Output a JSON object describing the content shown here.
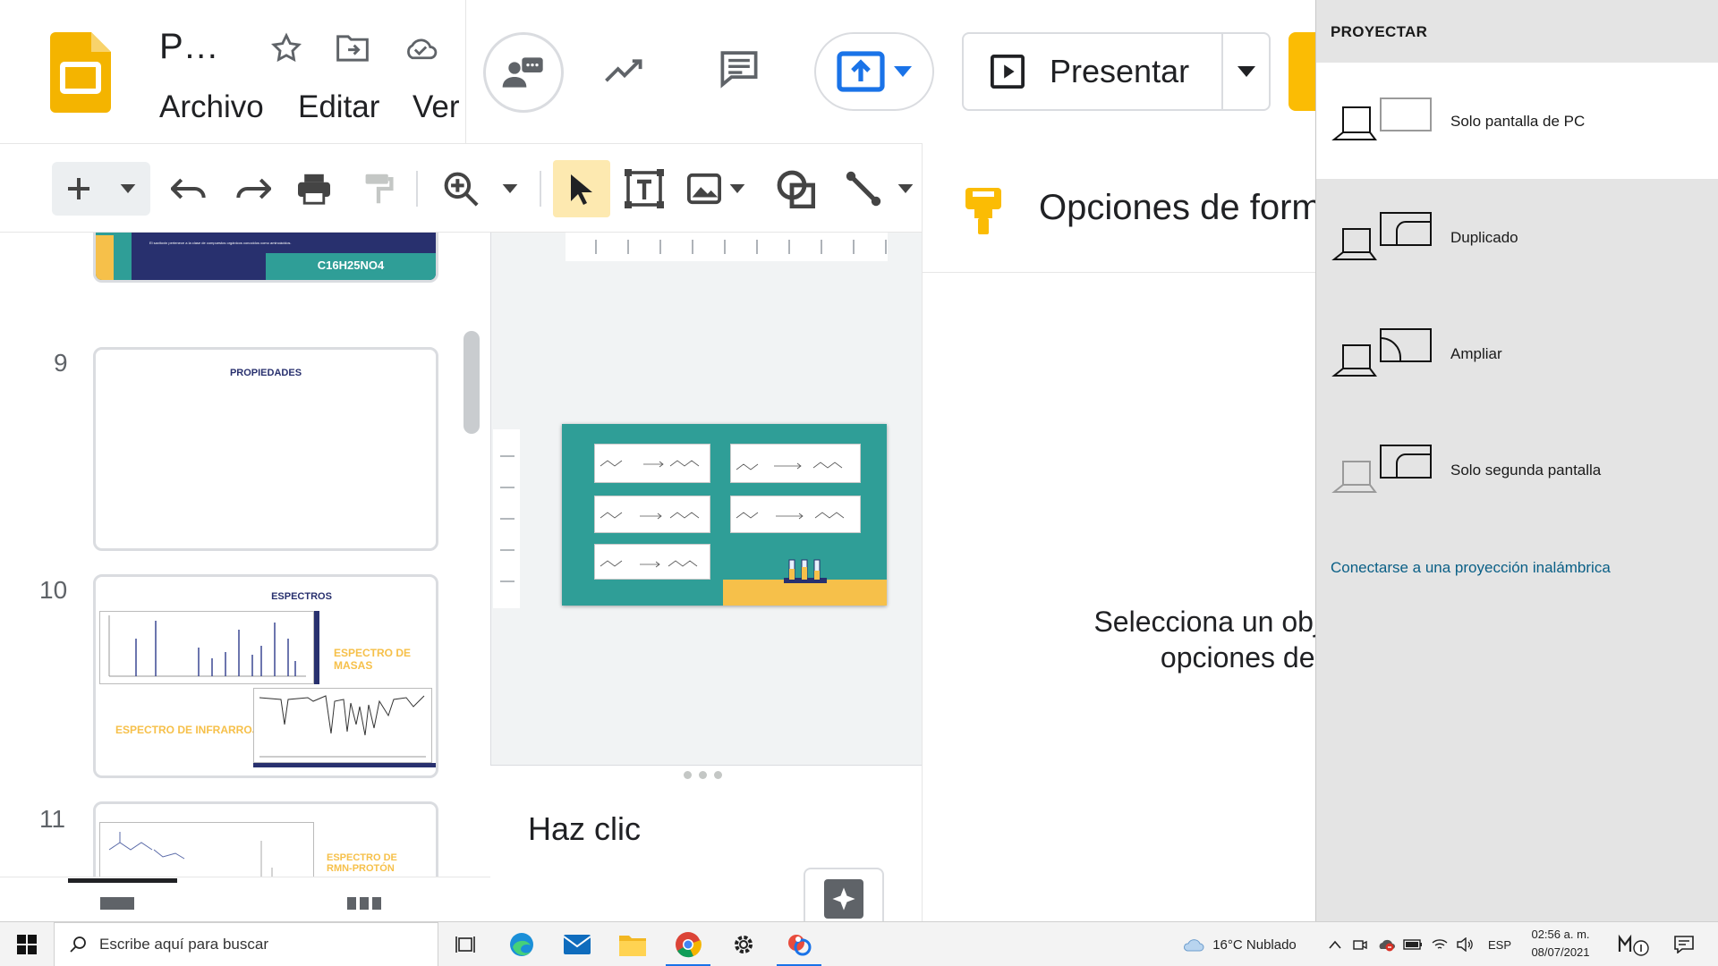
{
  "header": {
    "doc_title": "P…",
    "menu": [
      "Archivo",
      "Editar",
      "Ver"
    ],
    "present_label": "Presentar"
  },
  "filmstrip": {
    "slide8": {
      "formula": "C16H25NO4",
      "caption": "El saxitoxin pertenece a la clase de compuestos orgánicos conocidos como aminoácidos."
    },
    "slides": [
      {
        "num": "9",
        "title": "PROPIEDADES"
      },
      {
        "num": "10",
        "title": "ESPECTROS",
        "labels": [
          "ESPECTRO DE MASAS",
          "ESPECTRO DE INFRARROJO"
        ]
      },
      {
        "num": "11",
        "labels": [
          "ESPECTRO DE RMN-PROTÓN"
        ]
      }
    ]
  },
  "notes": {
    "placeholder": "Haz clic"
  },
  "format_panel": {
    "title": "Opciones de form",
    "message_line1": "Selecciona un objeto",
    "message_line2": "opciones de fo"
  },
  "projection": {
    "title": "PROYECTAR",
    "options": [
      {
        "label": "Solo pantalla de PC",
        "icon": "pc-only-icon",
        "selected": true
      },
      {
        "label": "Duplicado",
        "icon": "duplicate-icon",
        "selected": false
      },
      {
        "label": "Ampliar",
        "icon": "extend-icon",
        "selected": false
      },
      {
        "label": "Solo segunda pantalla",
        "icon": "second-screen-only-icon",
        "selected": false
      }
    ],
    "wireless_link": "Conectarse a una proyección inalámbrica"
  },
  "taskbar": {
    "search_placeholder": "Escribe aquí para buscar",
    "weather": "16°C  Nublado",
    "language": "ESP",
    "time": "02:56 a. m.",
    "date": "08/07/2021"
  },
  "colors": {
    "accent": "#fbbc04",
    "slide_teal": "#2f9e97",
    "slide_navy": "#28306e",
    "link": "#0a5f86"
  }
}
